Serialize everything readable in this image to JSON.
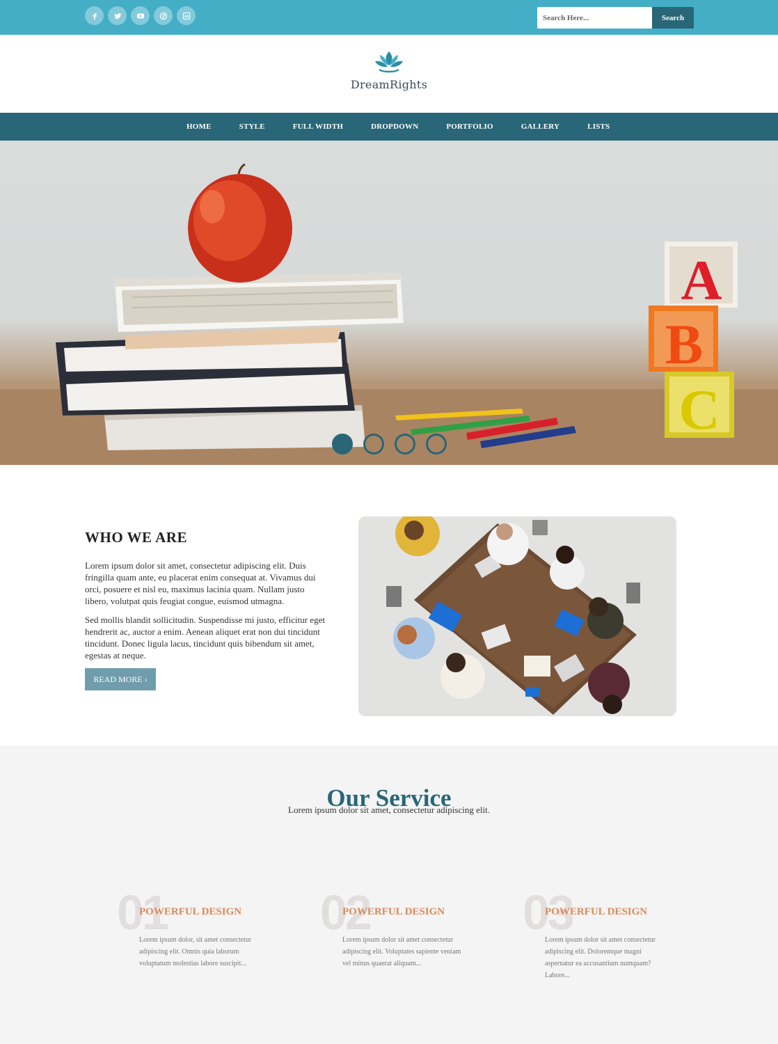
{
  "topbar": {
    "social": [
      {
        "icon": "facebook-icon"
      },
      {
        "icon": "twitter-icon"
      },
      {
        "icon": "youtube-icon"
      },
      {
        "icon": "pinterest-icon"
      },
      {
        "icon": "linkedin-icon"
      }
    ],
    "search": {
      "placeholder": "Search Here...",
      "button": "Search"
    }
  },
  "brand": {
    "name": "DreamRights",
    "logo_icon": "lotus-icon"
  },
  "nav": {
    "items": [
      "HOME",
      "STYLE",
      "FULL WIDTH",
      "DROPDOWN",
      "PORTFOLIO",
      "GALLERY",
      "LISTS"
    ]
  },
  "hero": {
    "image": "books-apple-abc-blocks",
    "blocks": [
      "A",
      "B",
      "C"
    ],
    "slides": 4,
    "active_slide": 1
  },
  "who": {
    "title": "WHO WE ARE",
    "para1": "Lorem ipsum dolor sit amet, consectetur adipiscing elit. Duis fringilla quam ante, eu placerat enim consequat at. Vivamus dui orci, posuere et nisl eu, maximus lacinia quam. Nullam justo libero, volutpat quis feugiat congue, euismod utmagna.",
    "para2": "Sed mollis blandit sollicitudin. Suspendisse mi justo, efficitur eget hendrerit ac, auctor a enim. Aenean aliquet erat non dui tincidunt tincidunt. Donec ligula lacus, tincidunt quis bibendum sit amet, egestas at neque.",
    "button": "READ MORE ›",
    "image": "team-meeting-topdown"
  },
  "services": {
    "title": "Our Service",
    "subtitle": "Lorem ipsum dolor sit amet, consectetur adipiscing elit.",
    "items": [
      {
        "num": "01",
        "title": "POWERFUL DESIGN",
        "text": "Lorem ipsum dolor, sit amet consectetur adipiscing elit. Omnis quia laborum voluptatum molestias labore suscipit..."
      },
      {
        "num": "02",
        "title": "POWERFUL DESIGN",
        "text": "Lorem ipsum dolor sit amet consectetur adipiscing elit. Voluptates sapiente veniam vel minus quaerat aliquam..."
      },
      {
        "num": "03",
        "title": "POWERFUL DESIGN",
        "text": "Lorem ipsum dolor sit amet consectetur adipiscing elit. Doloremque magni aspernatur ea accusantium numquam? Labore..."
      }
    ]
  },
  "colors": {
    "topbar": "#43aec6",
    "nav": "#286678",
    "accent": "#d98a5a",
    "button": "#6f9dab"
  }
}
